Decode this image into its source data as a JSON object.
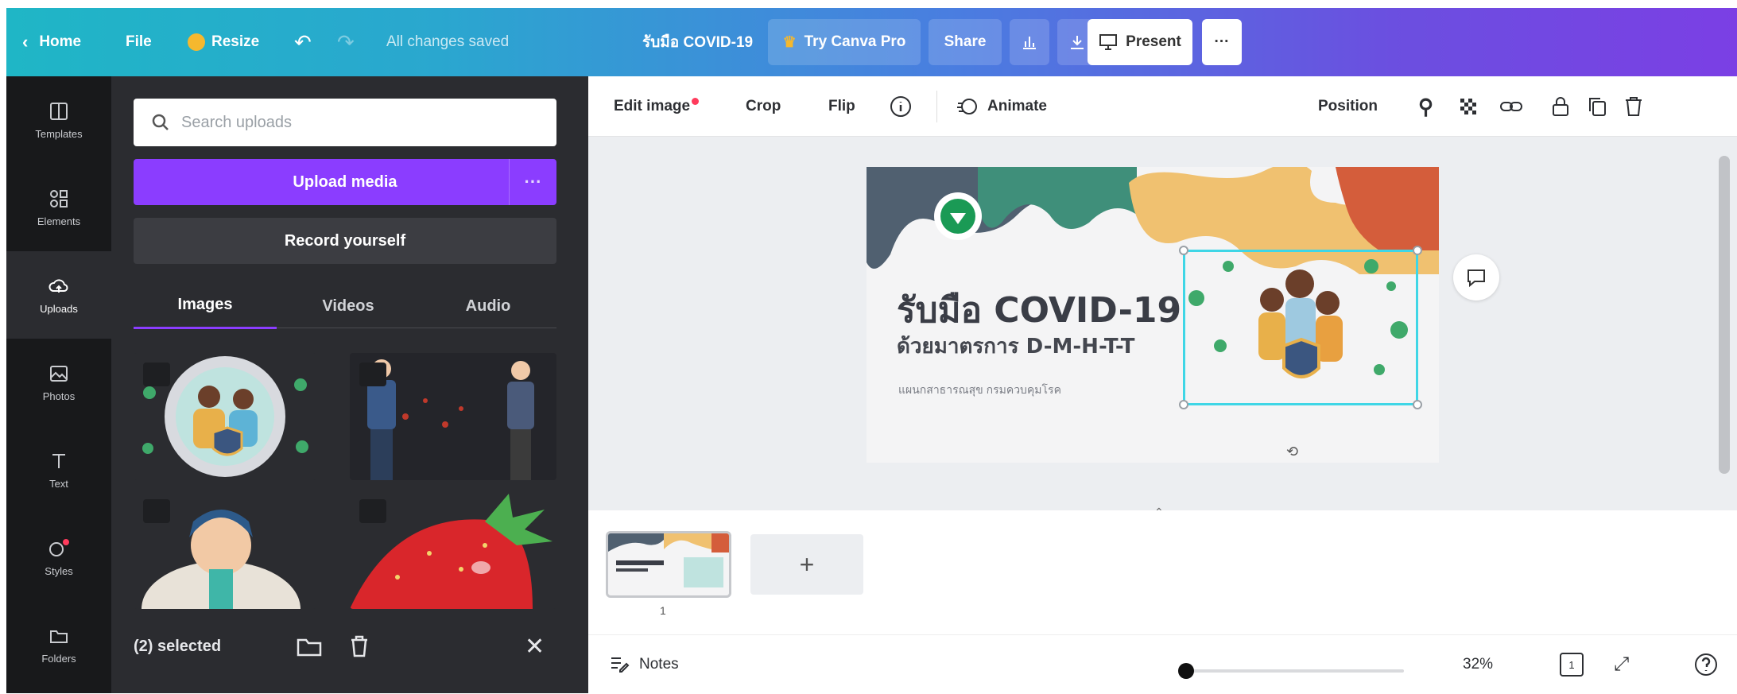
{
  "topbar": {
    "home": "Home",
    "file": "File",
    "resize": "Resize",
    "save_status": "All changes saved",
    "doc_title": "รับมือ COVID-19",
    "try_pro": "Try Canva Pro",
    "share": "Share",
    "present": "Present",
    "more": "···"
  },
  "rail": {
    "items": [
      {
        "label": "Templates",
        "icon": "templates-icon"
      },
      {
        "label": "Elements",
        "icon": "elements-icon"
      },
      {
        "label": "Uploads",
        "icon": "uploads-icon"
      },
      {
        "label": "Photos",
        "icon": "photos-icon"
      },
      {
        "label": "Text",
        "icon": "text-icon"
      },
      {
        "label": "Styles",
        "icon": "styles-icon"
      },
      {
        "label": "Folders",
        "icon": "folder-icon"
      }
    ]
  },
  "panel": {
    "search_placeholder": "Search uploads",
    "upload_button": "Upload media",
    "upload_more": "···",
    "record_button": "Record yourself",
    "tabs": [
      "Images",
      "Videos",
      "Audio"
    ],
    "selected_text": "(2) selected"
  },
  "editor_toolbar": {
    "edit_image": "Edit image",
    "crop": "Crop",
    "flip": "Flip",
    "animate": "Animate",
    "position": "Position"
  },
  "design": {
    "title": "รับมือ COVID-19",
    "subtitle": "ด้วยมาตรการ D-M-H-T-T",
    "small_text": "แผนกสาธารณสุข กรมควบคุมโรค"
  },
  "pages": {
    "current_page": "1",
    "add_page": "+"
  },
  "footer": {
    "notes": "Notes",
    "zoom": "32%",
    "zoom_fraction": 0.02,
    "page_count": "1"
  },
  "colors": {
    "brand_purple": "#8b3dff",
    "selection_cyan": "#3fd6e6",
    "panel_dark": "#2b2c30",
    "rail_dark": "#18191b"
  }
}
